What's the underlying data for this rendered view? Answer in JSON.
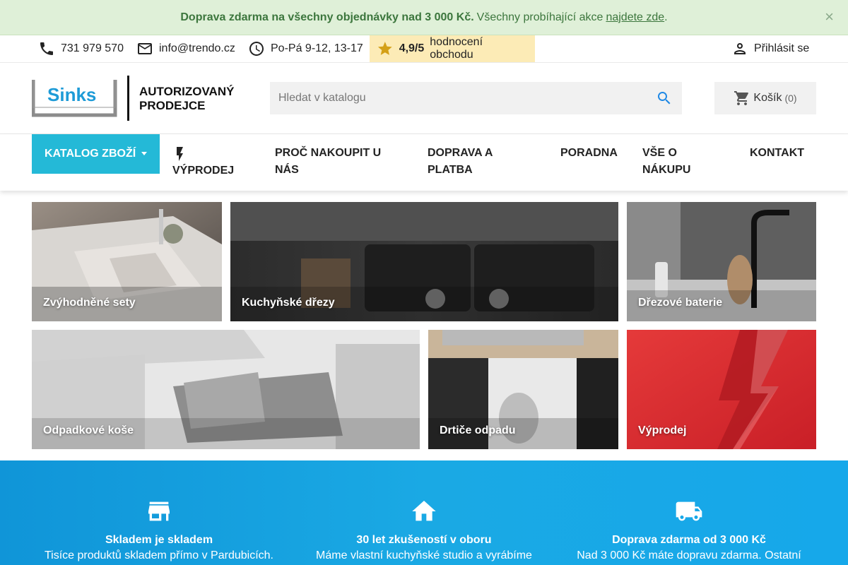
{
  "promo": {
    "bold_text": "Doprava zdarma na všechny objednávky nad 3 000 Kč.",
    "text": "Všechny probíhající akce",
    "link": "najdete zde",
    "end": ".",
    "close": "×"
  },
  "topbar": {
    "phone": "731 979 570",
    "email": "info@trendo.cz",
    "hours": "Po-Pá 9-12, 13-17",
    "rating_score": "4,9/5",
    "rating_text": "hodnocení obchodu",
    "login": "Přihlásit se"
  },
  "header": {
    "logo_brand": "Sinks",
    "logo_line1": "AUTORIZOVANÝ",
    "logo_line2": "PRODEJCE",
    "search_placeholder": "Hledat v katalogu",
    "cart_label": "Košík",
    "cart_count": "(0)"
  },
  "nav": {
    "catalog": "KATALOG ZBOŽÍ",
    "sale": "VÝPRODEJ",
    "why_line1": "PROČ NAKOUPIT U",
    "why_line2": "NÁS",
    "delivery_line1": "DOPRAVA A",
    "delivery_line2": "PLATBA",
    "advice": "PORADNA",
    "about_line1": "VŠE O",
    "about_line2": "NÁKUPU",
    "contact": "KONTAKT"
  },
  "tiles": [
    {
      "label": "Zvýhodněné sety"
    },
    {
      "label": "Kuchyňské dřezy"
    },
    {
      "label": "Dřezové baterie"
    },
    {
      "label": "Odpadkové koše"
    },
    {
      "label": "Drtiče odpadu"
    },
    {
      "label": "Výprodej"
    }
  ],
  "features": [
    {
      "icon": "store-icon",
      "title": "Skladem je skladem",
      "text": "Tisíce produktů skladem přímo v Pardubicích."
    },
    {
      "icon": "home-icon",
      "title": "30 let zkušeností v oboru",
      "text": "Máme vlastní kuchyňské studio a vyrábíme"
    },
    {
      "icon": "truck-icon",
      "title": "Doprava zdarma od 3 000 Kč",
      "text": "Nad 3 000 Kč máte dopravu zdarma. Ostatní"
    }
  ],
  "colors": {
    "accent": "#24b9d7",
    "promo_bg": "#dff0d8",
    "promo_text": "#3c763d",
    "rating_bg": "#fcebb6",
    "features_bg": "#1aa9e4"
  }
}
